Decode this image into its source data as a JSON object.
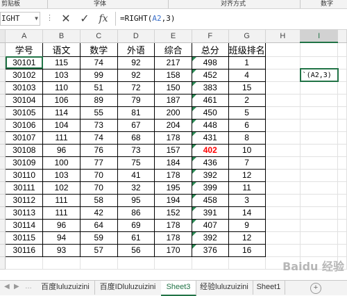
{
  "ribbon": {
    "groups": [
      "剪贴板",
      "字体",
      "对齐方式",
      "数字"
    ]
  },
  "formula_bar": {
    "name_box": "IGHT",
    "cancel_icon": "✕",
    "enter_icon": "✓",
    "fx_label": "fx",
    "formula_prefix": "=RIGHT(",
    "formula_arg": "A2",
    "formula_suffix": ",3)"
  },
  "columns": [
    "A",
    "B",
    "C",
    "D",
    "E",
    "F",
    "G",
    "H",
    "I"
  ],
  "active_column": "I",
  "headers": [
    "学号",
    "语文",
    "数学",
    "外语",
    "综合",
    "总分",
    "班级排名"
  ],
  "rows": [
    [
      "30101",
      "115",
      "74",
      "92",
      "217",
      "498",
      "1"
    ],
    [
      "30102",
      "103",
      "99",
      "92",
      "158",
      "452",
      "4"
    ],
    [
      "30103",
      "110",
      "51",
      "72",
      "150",
      "383",
      "15"
    ],
    [
      "30104",
      "106",
      "89",
      "79",
      "187",
      "461",
      "2"
    ],
    [
      "30105",
      "114",
      "55",
      "81",
      "200",
      "450",
      "5"
    ],
    [
      "30106",
      "104",
      "73",
      "67",
      "204",
      "448",
      "6"
    ],
    [
      "30107",
      "111",
      "74",
      "68",
      "178",
      "431",
      "8"
    ],
    [
      "30108",
      "96",
      "76",
      "73",
      "157",
      "402",
      "10"
    ],
    [
      "30109",
      "100",
      "77",
      "75",
      "184",
      "436",
      "7"
    ],
    [
      "30110",
      "103",
      "70",
      "41",
      "178",
      "392",
      "12"
    ],
    [
      "30111",
      "102",
      "70",
      "32",
      "195",
      "399",
      "11"
    ],
    [
      "30112",
      "111",
      "58",
      "95",
      "194",
      "458",
      "3"
    ],
    [
      "30113",
      "111",
      "42",
      "86",
      "152",
      "391",
      "14"
    ],
    [
      "30114",
      "96",
      "64",
      "69",
      "178",
      "407",
      "9"
    ],
    [
      "30115",
      "94",
      "59",
      "61",
      "178",
      "392",
      "12"
    ],
    [
      "30116",
      "93",
      "57",
      "56",
      "170",
      "376",
      "16"
    ]
  ],
  "highlight_value": "402",
  "formula_cell_text": "`(A2,3)",
  "sheet_tabs": [
    {
      "label": "百度luluzuizini",
      "active": false
    },
    {
      "label": "百度IDluluzuizini",
      "active": false
    },
    {
      "label": "Sheet3",
      "active": true
    },
    {
      "label": "经验luluzuizini",
      "active": false
    },
    {
      "label": "Sheet1",
      "active": false
    }
  ],
  "watermark": "Baidu 经验",
  "colors": {
    "accent": "#217346",
    "highlight_text": "#ff0000"
  }
}
